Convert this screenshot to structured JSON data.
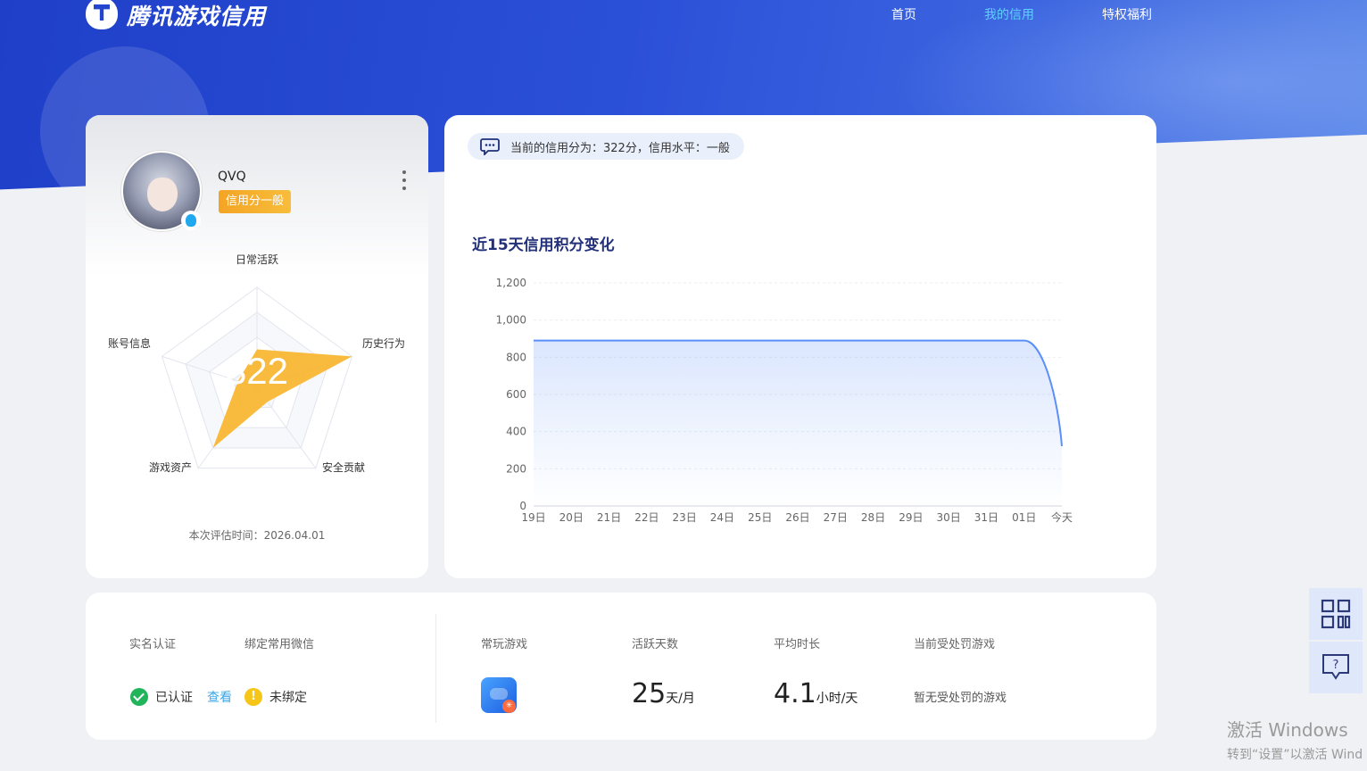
{
  "header": {
    "logo_text": "腾讯游戏信用",
    "nav": [
      {
        "label": "首页",
        "active": false
      },
      {
        "label": "我的信用",
        "active": true
      },
      {
        "label": "特权福利",
        "active": false
      }
    ]
  },
  "profile": {
    "username": "QVQ",
    "level_badge": "信用分一般",
    "score": "322",
    "radar_labels": {
      "top": "日常活跃",
      "right": "历史行为",
      "bottom_right": "安全贡献",
      "bottom_left": "游戏资产",
      "left": "账号信息"
    },
    "radar_values": {
      "日常活跃": 0.38,
      "历史行为": 1.0,
      "安全贡献": 0.18,
      "游戏资产": 0.75,
      "账号信息": 0.2
    },
    "eval_time": "本次评估时间：2026.04.01"
  },
  "credit": {
    "score_message": "当前的信用分为：322分，信用水平：一般",
    "chart_title": "近15天信用积分变化"
  },
  "chart_data": {
    "type": "area",
    "title": "近15天信用积分变化",
    "categories": [
      "19日",
      "20日",
      "21日",
      "22日",
      "23日",
      "24日",
      "25日",
      "26日",
      "27日",
      "28日",
      "29日",
      "30日",
      "31日",
      "01日",
      "今天"
    ],
    "series": [
      {
        "values": [
          890,
          890,
          890,
          890,
          890,
          890,
          890,
          890,
          890,
          890,
          890,
          890,
          890,
          890,
          322
        ]
      }
    ],
    "y_ticks": [
      "0",
      "200",
      "400",
      "600",
      "800",
      "1,000",
      "1,200"
    ],
    "ylim": [
      0,
      1200
    ],
    "grid": true,
    "line_color": "#5b8ff9"
  },
  "info": {
    "realname_label": "实名认证",
    "wechat_label": "绑定常用微信",
    "realname_status": "已认证",
    "view_link": "查看",
    "wechat_status": "未绑定",
    "frequent_games_label": "常玩游戏",
    "active_days_label": "活跃天数",
    "active_days_value": "25",
    "active_days_unit": "天/月",
    "avg_time_label": "平均时长",
    "avg_time_value": "4.1",
    "avg_time_unit": "小时/天",
    "punished_label": "当前受处罚游戏",
    "punished_value": "暂无受处罚的游戏"
  },
  "watermark": {
    "line1": "激活 Windows",
    "line2": "转到“设置”以激活 Wind"
  },
  "colors": {
    "brand_blue": "#2446cf",
    "active_nav": "#5fd1ff",
    "badge_orange": "#f4a424",
    "radar_fill": "#f9b52e",
    "chart_line": "#5b8ff9"
  }
}
